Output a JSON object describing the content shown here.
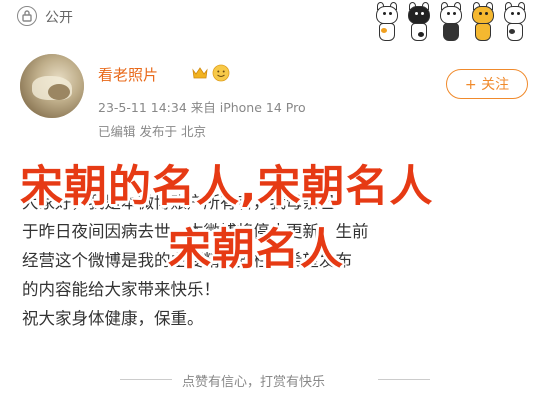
{
  "header": {
    "privacy_label": "公开"
  },
  "post": {
    "username": "看老照片",
    "time_device": "23-5-11 14:34  来自 iPhone 14 Pro",
    "edited_location": "已编辑  发布于 北京",
    "follow_label": "+ 关注",
    "lines": [
      "大家好，我是本微博账户所有者，我母亲已",
      "于昨日夜间因病去世，本微博将停止更新。生前",
      "经营这个微博是我的主要精神支柱，希望发布",
      "的内容能给大家带来快乐！",
      "祝大家身体健康，保重。"
    ]
  },
  "watermark": {
    "line1": "宋朝的名人,宋朝名人",
    "line2": "宋朝名人"
  },
  "footer": {
    "text": "点赞有信心，打赏有快乐"
  },
  "colors": {
    "accent": "#f08a2c",
    "username": "#e8691a",
    "watermark": "#e63a14"
  }
}
